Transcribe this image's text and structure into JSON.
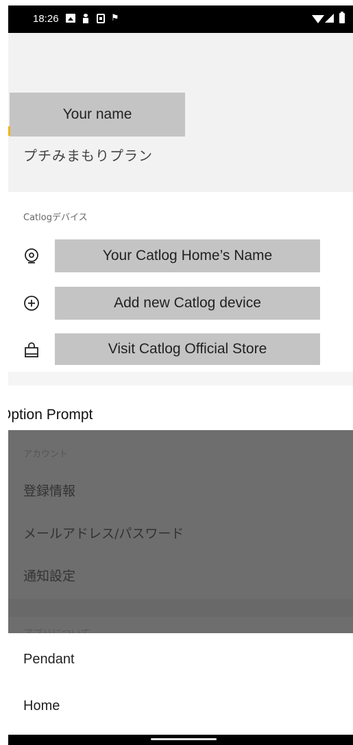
{
  "status_bar": {
    "time": "18:26",
    "icons": [
      "image-icon",
      "person-icon",
      "sim-icon",
      "flag-icon",
      "wifi-icon",
      "signal-icon",
      "battery-icon"
    ]
  },
  "profile": {
    "name": "Your name",
    "plan": "プチみまもりプラン"
  },
  "devices": {
    "section_label": "Catlogデバイス",
    "items": [
      {
        "icon": "catlog-home-icon",
        "label": "Your Catlog Home’s Name"
      },
      {
        "icon": "add-circle-icon",
        "label": "Add new Catlog device"
      },
      {
        "icon": "shopping-bag-icon",
        "label": "Visit Catlog Official Store"
      }
    ]
  },
  "option_prompt": "Option Prompt",
  "account": {
    "section_label": "アカウント",
    "items": [
      "登録情報",
      "メールアドレス/パスワード",
      "通知設定"
    ],
    "next_section_partial": "アプリについて"
  },
  "sheet": {
    "options": [
      "Pendant",
      "Home"
    ]
  },
  "colors": {
    "placeholder_gray": "#c4c4c4",
    "header_bg": "#f2f2f2",
    "scrim": "#6e6e6e",
    "accent": "#f2b21c"
  }
}
